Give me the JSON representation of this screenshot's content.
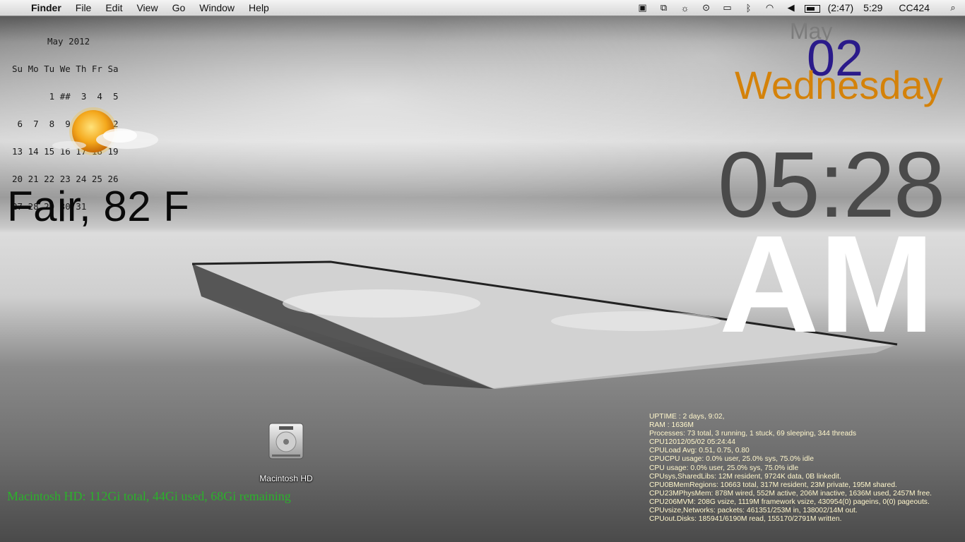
{
  "menubar": {
    "app": "Finder",
    "menus": [
      "File",
      "Edit",
      "View",
      "Go",
      "Window",
      "Help"
    ],
    "status_icons": [
      "terminal-icon",
      "display-sharing-icon",
      "brightness-icon",
      "time-machine-icon",
      "display-icon",
      "bluetooth-icon",
      "wifi-icon",
      "volume-icon"
    ],
    "battery_time": "(2:47)",
    "clock": "5:29",
    "user": "CC424"
  },
  "calendar": {
    "title": "May 2012",
    "rows": [
      "Su Mo Tu We Th Fr Sa",
      "       1 ##  3  4  5",
      " 6  7  8  9 10 11 12",
      "13 14 15 16 17 18 19",
      "20 21 22 23 24 25 26",
      "27 28 29 30 31"
    ]
  },
  "weather": {
    "text": "Fair, 82 F",
    "icon": "sunny-partly-cloudy-icon"
  },
  "date": {
    "month": "May",
    "day": "02",
    "weekday": "Wednesday"
  },
  "clock": {
    "time": "05:28",
    "ampm": "AM"
  },
  "desktop": {
    "disk_label": "Macintosh HD"
  },
  "disk_status": "Macintosh HD: 112Gi total, 44Gi used, 68Gi remaining",
  "sysinfo": [
    "UPTIME : 2 days, 9:02,",
    "RAM : 1636M",
    "Processes: 73 total, 3 running, 1 stuck, 69 sleeping, 344 threads",
    "CPU12012/05/02 05:24:44",
    "CPULoad Avg: 0.51, 0.75, 0.80",
    "CPUCPU usage: 0.0% user, 25.0% sys, 75.0% idle",
    "CPU usage: 0.0% user, 25.0% sys, 75.0% idle",
    "CPUsys,SharedLibs: 12M resident, 9724K data, 0B linkedit.",
    "CPU0BMemRegions: 10663 total, 317M resident, 23M private, 195M shared.",
    "CPU23MPhysMem: 878M wired, 552M active, 206M inactive, 1636M used, 2457M free.",
    "CPU206MVM: 208G vsize, 1119M framework vsize, 430954(0) pageins, 0(0) pageouts.",
    "CPUvsize,Networks: packets: 461351/253M in, 138002/14M out.",
    "CPUout.Disks: 185941/6190M read, 155170/2791M written."
  ]
}
